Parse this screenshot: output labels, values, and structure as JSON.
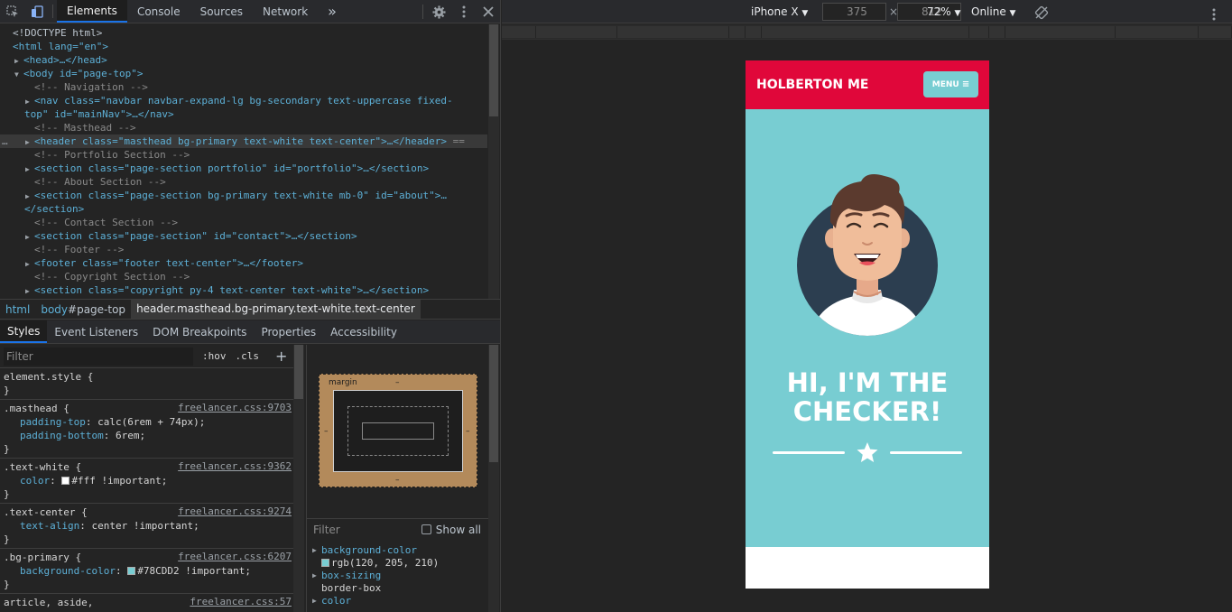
{
  "toolbar": {
    "tabs": [
      "Elements",
      "Console",
      "Sources",
      "Network"
    ],
    "active_tab": "Elements",
    "more_label": "»"
  },
  "dom_tree": {
    "doctype": "<!DOCTYPE html>",
    "html_open": "<html lang=\"en\">",
    "head": "<head>…</head>",
    "body_open": "<body id=\"page-top\">",
    "comment_nav": "<!-- Navigation -->",
    "nav_line1": "<nav class=\"navbar navbar-expand-lg bg-secondary text-uppercase fixed-",
    "nav_line2": "top\" id=\"mainNav\">…</nav>",
    "comment_masthead": "<!-- Masthead -->",
    "header_line": "<header class=\"masthead bg-primary text-white text-center\">…</header>",
    "header_suffix": "==",
    "comment_portfolio": "<!-- Portfolio Section -->",
    "portfolio_line": "<section class=\"page-section portfolio\" id=\"portfolio\">…</section>",
    "comment_about": "<!-- About Section -->",
    "about_line1": "<section class=\"page-section bg-primary text-white mb-0\" id=\"about\">…",
    "about_line2": "</section>",
    "comment_contact": "<!-- Contact Section -->",
    "contact_line": "<section class=\"page-section\" id=\"contact\">…</section>",
    "comment_footer": "<!-- Footer -->",
    "footer_line": "<footer class=\"footer text-center\">…</footer>",
    "comment_copyright": "<!-- Copyright Section -->",
    "copyright_line": "<section class=\"copyright py-4 text-center text-white\">…</section>"
  },
  "breadcrumbs": {
    "html": "html",
    "body_tag": "body",
    "body_id": "#page-top",
    "header": "header.masthead.bg-primary.text-white.text-center"
  },
  "styles_tabs": [
    "Styles",
    "Event Listeners",
    "DOM Breakpoints",
    "Properties",
    "Accessibility"
  ],
  "styles": {
    "filter_placeholder": "Filter",
    "hov": ":hov",
    "cls": ".cls",
    "add": "+",
    "rules": [
      {
        "selector": "element.style {",
        "source": "",
        "props": [],
        "close": "}"
      },
      {
        "selector": ".masthead {",
        "source": "freelancer.css:9703",
        "props": [
          {
            "name": "padding-top",
            "value": "calc(6rem + 74px);"
          },
          {
            "name": "padding-bottom",
            "value": "6rem;"
          }
        ],
        "close": "}"
      },
      {
        "selector": ".text-white {",
        "source": "freelancer.css:9362",
        "props": [
          {
            "name": "color",
            "value": "#fff !important;",
            "swatch": "#ffffff"
          }
        ],
        "close": "}"
      },
      {
        "selector": ".text-center {",
        "source": "freelancer.css:9274",
        "props": [
          {
            "name": "text-align",
            "value": "center !important;"
          }
        ],
        "close": "}"
      },
      {
        "selector": ".bg-primary {",
        "source": "freelancer.css:6207",
        "props": [
          {
            "name": "background-color",
            "value": "#78CDD2 !important;",
            "swatch": "#78CDD2"
          }
        ],
        "close": "}"
      },
      {
        "selector": "article, aside,",
        "source": "freelancer.css:57",
        "props": [],
        "close": ""
      }
    ]
  },
  "box_model": {
    "margin_label": "margin",
    "dash": "–"
  },
  "computed": {
    "filter_placeholder": "Filter",
    "show_all": "Show all",
    "props": [
      {
        "name": "background-color",
        "value": "rgb(120, 205, 210)",
        "swatch": "#78cdd2"
      },
      {
        "name": "box-sizing",
        "value": "border-box"
      },
      {
        "name": "color",
        "value": ""
      }
    ]
  },
  "device_bar": {
    "device": "iPhone X",
    "width": "375",
    "height": "812",
    "times": "×",
    "zoom": "72%",
    "network": "Online"
  },
  "page": {
    "brand": "HOLBERTON ME",
    "menu_label": "MENU",
    "headline_line1": "HI, I'M THE",
    "headline_line2": "CHECKER!"
  },
  "colors": {
    "primary": "#78CDD2",
    "navbar": "#e0073a",
    "accent": "#1a73e8"
  }
}
